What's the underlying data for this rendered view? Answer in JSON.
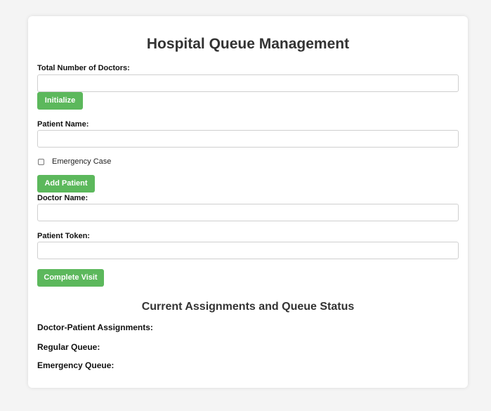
{
  "page": {
    "title": "Hospital Queue Management"
  },
  "doctors": {
    "label": "Total Number of Doctors:",
    "value": "",
    "initialize_label": "Initialize"
  },
  "patient": {
    "name_label": "Patient Name:",
    "name_value": "",
    "emergency_label": "Emergency Case",
    "emergency_checked": false,
    "add_label": "Add Patient"
  },
  "visit": {
    "doctor_label": "Doctor Name:",
    "doctor_value": "",
    "token_label": "Patient Token:",
    "token_value": "",
    "complete_label": "Complete Visit"
  },
  "status": {
    "heading": "Current Assignments and Queue Status",
    "assignments_label": "Doctor-Patient Assignments:",
    "regular_label": "Regular Queue:",
    "emergency_label": "Emergency Queue:"
  },
  "colors": {
    "button": "#5cb85c",
    "background": "#f4f4f4",
    "card": "#ffffff"
  }
}
